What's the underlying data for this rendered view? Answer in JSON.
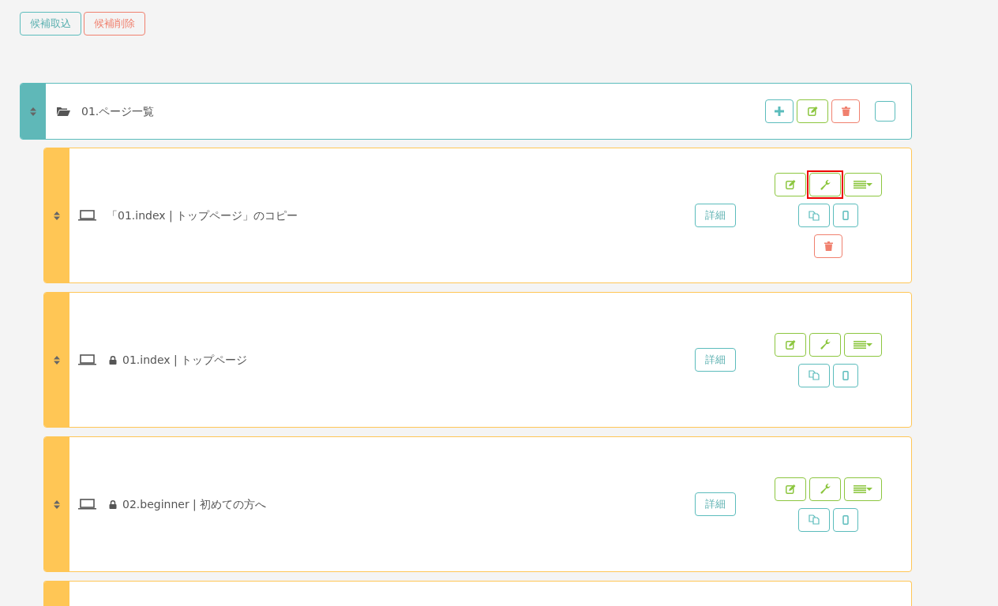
{
  "top_buttons": [
    {
      "label": "候補取込",
      "kind": "import"
    },
    {
      "label": "候補削除",
      "kind": "delete"
    }
  ],
  "folder": {
    "title": "01.ページ一覧",
    "buttons": [
      {
        "kind": "add"
      },
      {
        "kind": "edit"
      },
      {
        "kind": "delete"
      },
      {
        "kind": "blank"
      }
    ]
  },
  "pages": [
    {
      "title": "「01.index | トップページ」のコピー",
      "locked": false,
      "detail_label": "詳細",
      "button_rows": [
        [
          {
            "kind": "edit",
            "highlighted": false
          },
          {
            "kind": "wrench",
            "highlighted": true
          },
          {
            "kind": "list",
            "highlighted": false
          }
        ],
        [
          {
            "kind": "copy",
            "highlighted": false
          },
          {
            "kind": "mobile",
            "highlighted": false
          }
        ],
        [
          {
            "kind": "delete",
            "highlighted": false
          }
        ]
      ]
    },
    {
      "title": "01.index | トップページ",
      "locked": true,
      "detail_label": "詳細",
      "button_rows": [
        [
          {
            "kind": "edit",
            "highlighted": false
          },
          {
            "kind": "wrench",
            "highlighted": false
          },
          {
            "kind": "list",
            "highlighted": false
          }
        ],
        [
          {
            "kind": "copy",
            "highlighted": false
          },
          {
            "kind": "mobile",
            "highlighted": false
          }
        ]
      ]
    },
    {
      "title": "02.beginner | 初めての方へ",
      "locked": true,
      "detail_label": "詳細",
      "button_rows": [
        [
          {
            "kind": "edit",
            "highlighted": false
          },
          {
            "kind": "wrench",
            "highlighted": false
          },
          {
            "kind": "list",
            "highlighted": false
          }
        ],
        [
          {
            "kind": "copy",
            "highlighted": false
          },
          {
            "kind": "mobile",
            "highlighted": false
          }
        ]
      ]
    }
  ],
  "more_pages_below": true
}
